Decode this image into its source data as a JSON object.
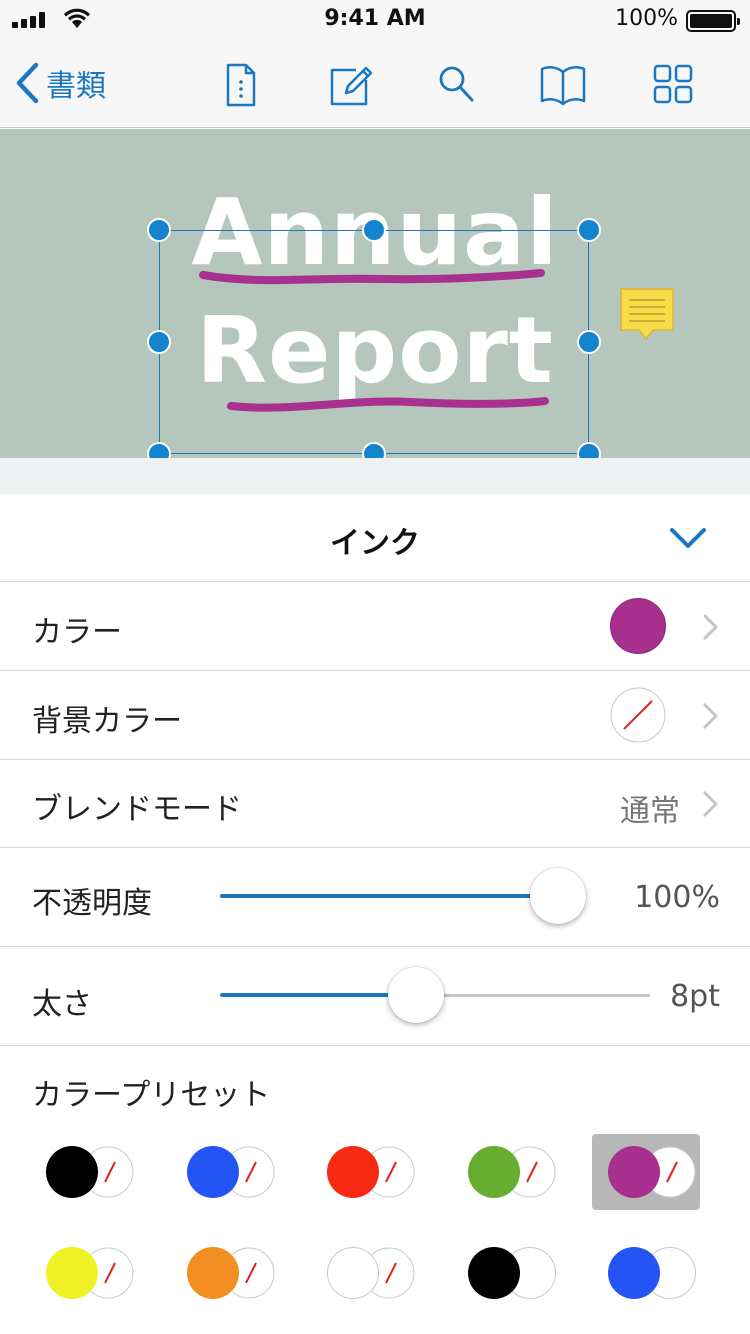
{
  "status_bar": {
    "time": "9:41 AM",
    "battery_percent": "100%",
    "icons": [
      "signal-icon",
      "wifi-icon",
      "battery-icon"
    ]
  },
  "nav": {
    "back_label": "書類",
    "back_icon": "chevron-left-icon",
    "icons": [
      "document-info-icon",
      "edit-annotation-icon",
      "search-icon",
      "book-icon",
      "thumbnail-grid-icon"
    ],
    "accent_color": "#1b78c0"
  },
  "document": {
    "line1": "Annual",
    "line2": "Report",
    "background_color": "#b5c6bd",
    "ink_color": "#a8308f",
    "note_icon": "note-comment-icon"
  },
  "inspector": {
    "title": "インク",
    "collapse_icon": "chevron-down-icon",
    "color": {
      "label": "カラー",
      "value_color": "#a8308f"
    },
    "background_color": {
      "label": "背景カラー",
      "value_color": "none"
    },
    "blend_mode": {
      "label": "ブレンドモード",
      "value": "通常"
    },
    "opacity": {
      "label": "不透明度",
      "value": "100%",
      "fraction": 1.0
    },
    "thickness": {
      "label": "太さ",
      "value": "8pt",
      "fraction": 0.45
    },
    "presets_label": "カラープリセット",
    "presets": [
      {
        "foreground": "#000000",
        "background": "none",
        "selected": false
      },
      {
        "foreground": "#2355f5",
        "background": "none",
        "selected": false
      },
      {
        "foreground": "#f52a10",
        "background": "none",
        "selected": false
      },
      {
        "foreground": "#66ad30",
        "background": "none",
        "selected": false
      },
      {
        "foreground": "#a8308f",
        "background": "none",
        "selected": true
      },
      {
        "foreground": "#f1f225",
        "background": "none",
        "selected": false
      },
      {
        "foreground": "#f38f22",
        "background": "none",
        "selected": false
      },
      {
        "foreground": "#ffffff",
        "background": "none",
        "selected": false
      },
      {
        "foreground": "#000000",
        "background": "#ffffff",
        "selected": false
      },
      {
        "foreground": "#2355f5",
        "background": "#ffffff",
        "selected": false
      }
    ]
  }
}
